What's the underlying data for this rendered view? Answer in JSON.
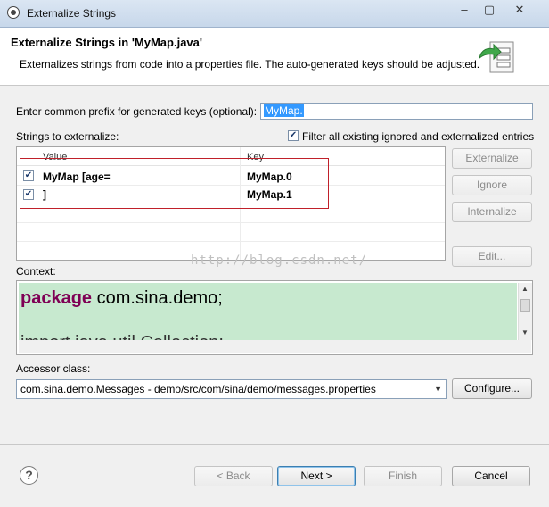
{
  "window": {
    "title": "Externalize Strings",
    "controls": [
      "–",
      "▢",
      "✕"
    ]
  },
  "header": {
    "title": "Externalize Strings in 'MyMap.java'",
    "description": "Externalizes strings from code into a properties file. The auto-generated keys should be adjusted."
  },
  "prefix": {
    "label": "Enter common prefix for generated keys (optional):",
    "value": "MyMap."
  },
  "strings": {
    "label": "Strings to externalize:",
    "filter_label": "Filter all existing ignored and externalized entries",
    "filter_checked": true,
    "columns": [
      "Value",
      "Key"
    ],
    "rows": [
      {
        "checked": true,
        "value": "MyMap [age=",
        "key": "MyMap.0"
      },
      {
        "checked": true,
        "value": "]",
        "key": "MyMap.1"
      }
    ]
  },
  "side_buttons": {
    "externalize": "Externalize",
    "ignore": "Ignore",
    "internalize": "Internalize",
    "edit": "Edit..."
  },
  "context": {
    "label": "Context:",
    "keyword": "package",
    "code_rest": " com.sina.demo;",
    "code_partial": "import java.util.Collection;"
  },
  "watermark": "http://blog.csdn.net/",
  "accessor": {
    "label": "Accessor class:",
    "value": "com.sina.demo.Messages - demo/src/com/sina/demo/messages.properties",
    "configure_label": "Configure..."
  },
  "footer": {
    "help": "?",
    "back": "< Back",
    "next": "Next >",
    "finish": "Finish",
    "cancel": "Cancel"
  }
}
